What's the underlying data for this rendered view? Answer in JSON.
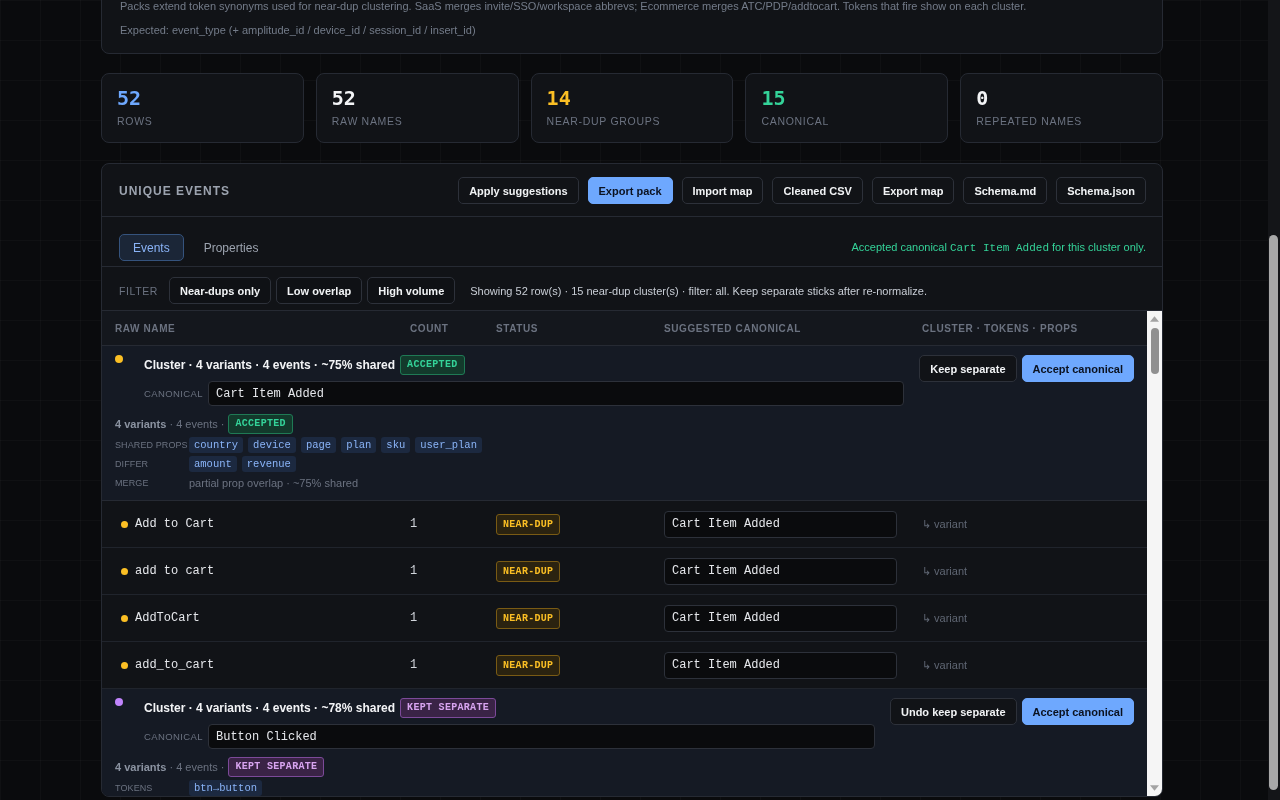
{
  "intro": {
    "lines": [
      "Packs extend token synonyms used for near-dup clustering. SaaS merges invite/SSO/workspace abbrevs; Ecommerce merges ATC/PDP/addtocart. Tokens that fire show on each cluster.",
      "Expected: event_type (+ amplitude_id / device_id / session_id / insert_id)"
    ]
  },
  "stats": [
    {
      "value": "52",
      "label": "ROWS",
      "color": "#6ea8fe"
    },
    {
      "value": "52",
      "label": "RAW NAMES",
      "color": "#f3f4f6"
    },
    {
      "value": "14",
      "label": "NEAR-DUP GROUPS",
      "color": "#fbbf24"
    },
    {
      "value": "15",
      "label": "CANONICAL",
      "color": "#34d399"
    },
    {
      "value": "0",
      "label": "REPEATED NAMES",
      "color": "#f3f4f6"
    }
  ],
  "panel": {
    "title": "UNIQUE EVENTS",
    "actions": [
      {
        "label": "Apply suggestions",
        "primary": false
      },
      {
        "label": "Export pack",
        "primary": true
      },
      {
        "label": "Import map",
        "primary": false
      },
      {
        "label": "Cleaned CSV",
        "primary": false
      },
      {
        "label": "Export map",
        "primary": false
      },
      {
        "label": "Schema.md",
        "primary": false
      },
      {
        "label": "Schema.json",
        "primary": false
      }
    ],
    "tabs": [
      {
        "label": "Events",
        "selected": true
      },
      {
        "label": "Properties",
        "selected": false
      }
    ],
    "notice": {
      "before": "Accepted canonical",
      "code": "Cart Item Added",
      "after": "for this cluster only."
    },
    "filter": {
      "label": "FILTER",
      "options": [
        {
          "label": "Near-dups only",
          "selected": false
        },
        {
          "label": "Low overlap",
          "selected": false
        },
        {
          "label": "High volume",
          "selected": false
        }
      ],
      "summary": "Showing 52 row(s) · 15 near-dup cluster(s) · filter: all. Keep separate sticks after re-normalize."
    },
    "table": {
      "columns": [
        "RAW NAME",
        "COUNT",
        "STATUS",
        "SUGGESTED CANONICAL",
        "CLUSTER · TOKENS · PROPS"
      ],
      "rows": [
        {
          "kind": "cluster",
          "color": "#fbbf24",
          "title": "Cluster · 4 variants · 4 events · ~75% shared",
          "status": {
            "label": "ACCEPTED",
            "kind": "accepted"
          },
          "canonical_label": "CANONICAL",
          "canonical": "Cart Item Added",
          "actions": [
            {
              "label": "Keep separate",
              "primary": false
            },
            {
              "label": "Accept canonical",
              "primary": true
            }
          ],
          "summary": {
            "text": "**4 variants** · 4 events ·",
            "status": {
              "label": "ACCEPTED",
              "kind": "accepted"
            }
          },
          "details": [
            {
              "kind": "tags",
              "label": "SHARED PROPS",
              "tags": [
                "country",
                "device",
                "page",
                "plan",
                "sku",
                "user_plan"
              ]
            },
            {
              "kind": "tags",
              "label": "DIFFER",
              "tags": [
                "amount",
                "revenue"
              ]
            },
            {
              "kind": "text",
              "label": "MERGE",
              "text": "partial prop overlap · ~75% shared"
            }
          ]
        },
        {
          "kind": "variant",
          "color": "#fbbf24",
          "name": "Add to Cart",
          "count": "1",
          "status": {
            "label": "NEAR-DUP",
            "kind": "near_dup"
          },
          "canonical": "Cart Item Added",
          "note": "↳ variant"
        },
        {
          "kind": "variant",
          "color": "#fbbf24",
          "name": "add to cart",
          "count": "1",
          "status": {
            "label": "NEAR-DUP",
            "kind": "near_dup"
          },
          "canonical": "Cart Item Added",
          "note": "↳ variant"
        },
        {
          "kind": "variant",
          "color": "#fbbf24",
          "name": "AddToCart",
          "count": "1",
          "status": {
            "label": "NEAR-DUP",
            "kind": "near_dup"
          },
          "canonical": "Cart Item Added",
          "note": "↳ variant"
        },
        {
          "kind": "variant",
          "color": "#fbbf24",
          "name": "add_to_cart",
          "count": "1",
          "status": {
            "label": "NEAR-DUP",
            "kind": "near_dup"
          },
          "canonical": "Cart Item Added",
          "note": "↳ variant"
        },
        {
          "kind": "cluster",
          "color": "#c084fc",
          "title": "Cluster · 4 variants · 4 events · ~78% shared",
          "status": {
            "label": "KEPT SEPARATE",
            "kind": "kept_separate"
          },
          "canonical_label": "CANONICAL",
          "canonical": "Button Clicked",
          "actions": [
            {
              "label": "Undo keep separate",
              "primary": false
            },
            {
              "label": "Accept canonical",
              "primary": true
            }
          ],
          "summary": {
            "text": "**4 variants** · 4 events ·",
            "status": {
              "label": "KEPT SEPARATE",
              "kind": "kept_separate"
            }
          },
          "details": [
            {
              "kind": "tags",
              "label": "TOKENS",
              "tags": [
                "btn→button"
              ]
            }
          ]
        }
      ]
    }
  }
}
